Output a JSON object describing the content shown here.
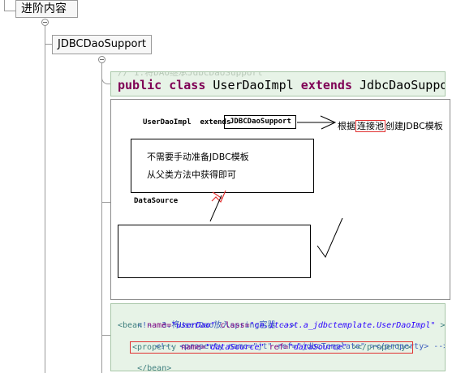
{
  "tree": {
    "root_label": "进阶内容",
    "child_label": "JDBCDaoSupport"
  },
  "code1": {
    "faded_comment": "// 1.将DAO继承JdbcDaoSupport",
    "kw_public": "public",
    "kw_class": "class",
    "class_name": "UserDaoImpl",
    "kw_extends": "extends",
    "super_name": "JdbcDaoSupport"
  },
  "diagram": {
    "class_text": "UserDaoImpl  extends",
    "super_box": "JDBCDaoSupport",
    "note_before": "根据",
    "note_highlight": "连接池",
    "note_after": "创建JDBC模板",
    "box_line1": "不需要手动准备JDBC模板",
    "box_line2": "从父类方法中获得即可",
    "datasource_label": "DataSource"
  },
  "code2": {
    "comment": "<!-- 3.将UserDao放入spring容器 -->",
    "bean_open": "<bean",
    "attr_name": "name=",
    "val_name": "\"userDao\"",
    "attr_class": "class=",
    "val_class": "\"cn.itcast.a_jdbctemplate.UserDaoImpl\"",
    "bean_open_end": ">",
    "commented_prop": "<!-- <property name=\"jt\" ref=\"jdbcTemplate\" ></property> -->",
    "prop_open": "<property",
    "prop_attr_name": "name=",
    "prop_val_name": "\"dataSource\"",
    "prop_attr_ref": "ref=",
    "prop_val_ref": "\"dataSource\"",
    "prop_close": "></property>",
    "bean_close": "</bean>"
  },
  "colors": {
    "keyword": "#7f0055",
    "xml_tag": "#3f7f7f",
    "xml_attr": "#7f007f",
    "xml_value": "#2a00ff",
    "xml_comment": "#3f5fbf",
    "highlight_border": "#e03030"
  }
}
